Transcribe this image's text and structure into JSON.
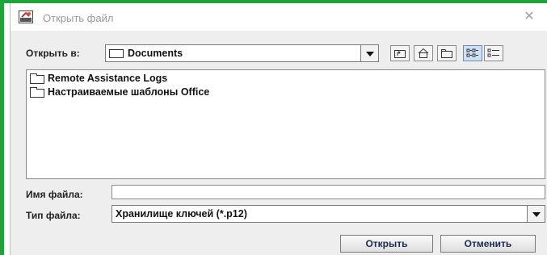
{
  "window": {
    "title": "Открыть файл"
  },
  "lookin": {
    "label": "Открыть в:",
    "value": "Documents"
  },
  "toolbar": {
    "buttons": [
      {
        "name": "up-one-level-icon"
      },
      {
        "name": "home-icon"
      },
      {
        "name": "new-folder-icon"
      },
      {
        "name": "list-view-icon",
        "active": true
      },
      {
        "name": "details-view-icon"
      }
    ]
  },
  "files": [
    {
      "name": "Remote Assistance Logs"
    },
    {
      "name": "Настраиваемые шаблоны Office"
    }
  ],
  "filename": {
    "label": "Имя файла:",
    "value": ""
  },
  "filetype": {
    "label": "Тип файла:",
    "value": "Хранилище ключей (*.p12)"
  },
  "actions": {
    "open": "Открыть",
    "cancel": "Отменить"
  },
  "colors": {
    "accent_green": "#1fa43a",
    "dialog_bg": "#eeeeee"
  }
}
